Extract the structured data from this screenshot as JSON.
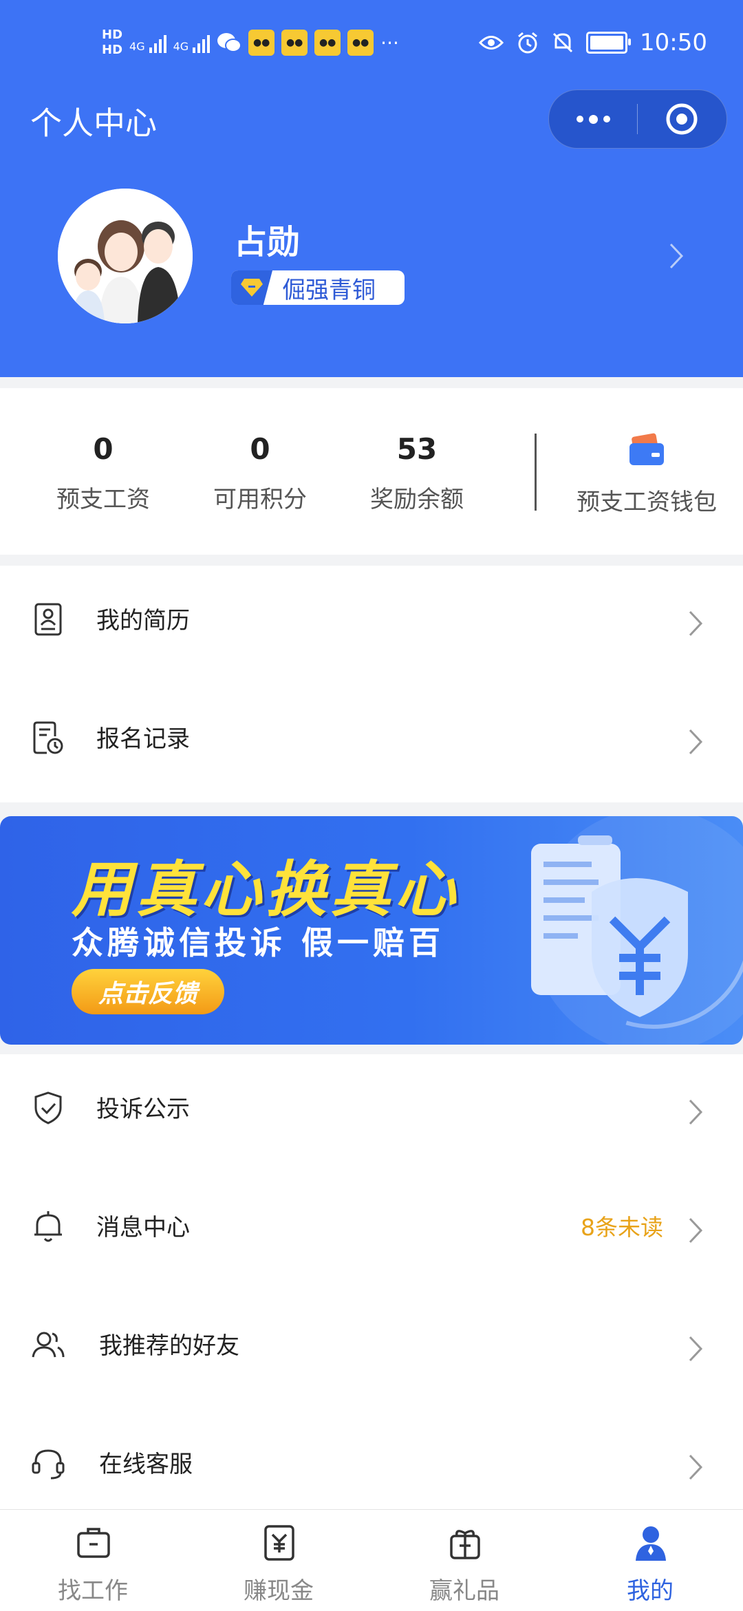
{
  "status_bar": {
    "hd1": "HD",
    "hd2": "HD",
    "sim1_net": "4G",
    "sim2_net": "4G",
    "more": "···",
    "time": "10:50"
  },
  "header": {
    "title": "个人中心",
    "user_name": "占勋",
    "level": "倔强青铜"
  },
  "stats": {
    "items": [
      {
        "value": "0",
        "label": "预支工资"
      },
      {
        "value": "0",
        "label": "可用积分"
      },
      {
        "value": "53",
        "label": "奖励余额"
      }
    ],
    "wallet_label": "预支工资钱包"
  },
  "menu1": [
    {
      "label": "我的简历",
      "icon": "resume-icon"
    },
    {
      "label": "报名记录",
      "icon": "record-icon"
    }
  ],
  "banner": {
    "title": "用真心换真心",
    "subtitle": "众腾诚信投诉 假一赔百",
    "button": "点击反馈",
    "shield_symbol": "¥"
  },
  "menu2": [
    {
      "label": "投诉公示",
      "icon": "shield-check-icon",
      "extra": ""
    },
    {
      "label": "消息中心",
      "icon": "bell-icon",
      "extra": "8条未读"
    },
    {
      "label": "我推荐的好友",
      "icon": "friends-icon",
      "extra": ""
    },
    {
      "label": "在线客服",
      "icon": "headset-icon",
      "extra": ""
    }
  ],
  "tabbar": [
    {
      "label": "找工作",
      "icon": "briefcase-icon",
      "active": false
    },
    {
      "label": "赚现金",
      "icon": "cash-icon",
      "active": false
    },
    {
      "label": "赢礼品",
      "icon": "gift-icon",
      "active": false
    },
    {
      "label": "我的",
      "icon": "person-icon",
      "active": true
    }
  ],
  "colors": {
    "header_blue": "#3d73f5",
    "accent_blue": "#2f63e0",
    "unread_orange": "#e8a31a",
    "banner_title_yellow": "#ffe23a"
  }
}
